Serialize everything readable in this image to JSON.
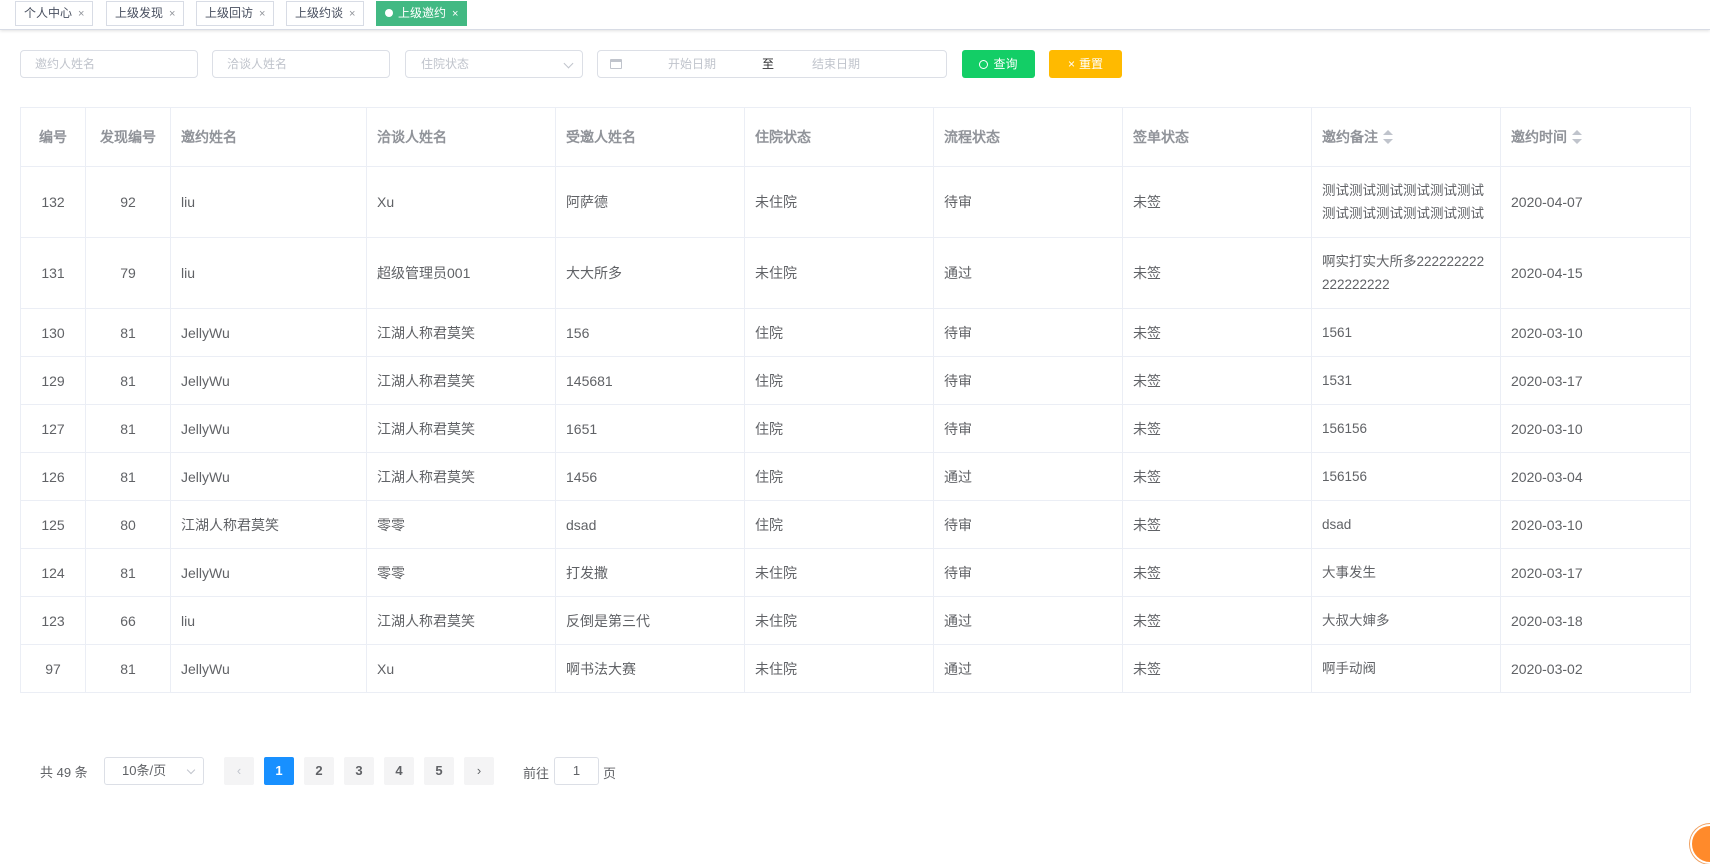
{
  "tabs": [
    {
      "label": "个人中心",
      "active": false
    },
    {
      "label": "上级发现",
      "active": false
    },
    {
      "label": "上级回访",
      "active": false
    },
    {
      "label": "上级约谈",
      "active": false
    },
    {
      "label": "上级邀约",
      "active": true
    }
  ],
  "tab_close_glyph": "×",
  "filters": {
    "inviter_placeholder": "邀约人姓名",
    "negotiator_placeholder": "洽谈人姓名",
    "status_placeholder": "住院状态",
    "date_start_placeholder": "开始日期",
    "date_separator": "至",
    "date_end_placeholder": "结束日期",
    "search_label": "查询",
    "reset_label": "重置"
  },
  "table": {
    "headers": [
      "编号",
      "发现编号",
      "邀约姓名",
      "洽谈人姓名",
      "受邀人姓名",
      "住院状态",
      "流程状态",
      "签单状态",
      "邀约备注",
      "邀约时间"
    ],
    "rows": [
      [
        "132",
        "92",
        "liu",
        "Xu",
        "阿萨德",
        "未住院",
        "待审",
        "未签",
        "测试测试测试测试测试测试测试测试测试测试测试测试",
        "2020-04-07"
      ],
      [
        "131",
        "79",
        "liu",
        "超级管理员001",
        "大大所多",
        "未住院",
        "通过",
        "未签",
        "啊实打实大所多222222222222222222",
        "2020-04-15"
      ],
      [
        "130",
        "81",
        "JellyWu",
        "江湖人称君莫笑",
        "156",
        "住院",
        "待审",
        "未签",
        "1561",
        "2020-03-10"
      ],
      [
        "129",
        "81",
        "JellyWu",
        "江湖人称君莫笑",
        "145681",
        "住院",
        "待审",
        "未签",
        "1531",
        "2020-03-17"
      ],
      [
        "127",
        "81",
        "JellyWu",
        "江湖人称君莫笑",
        "1651",
        "住院",
        "待审",
        "未签",
        "156156",
        "2020-03-10"
      ],
      [
        "126",
        "81",
        "JellyWu",
        "江湖人称君莫笑",
        "1456",
        "住院",
        "通过",
        "未签",
        "156156",
        "2020-03-04"
      ],
      [
        "125",
        "80",
        "江湖人称君莫笑",
        "零零",
        "dsad",
        "住院",
        "待审",
        "未签",
        "dsad",
        "2020-03-10"
      ],
      [
        "124",
        "81",
        "JellyWu",
        "零零",
        "打发撒",
        "未住院",
        "待审",
        "未签",
        "大事发生",
        "2020-03-17"
      ],
      [
        "123",
        "66",
        "liu",
        "江湖人称君莫笑",
        "反倒是第三代",
        "未住院",
        "通过",
        "未签",
        "大叔大婶多",
        "2020-03-18"
      ],
      [
        "97",
        "81",
        "JellyWu",
        "Xu",
        "啊书法大赛",
        "未住院",
        "通过",
        "未签",
        "啊手动阀",
        "2020-03-02"
      ]
    ]
  },
  "pagination": {
    "total_text": "共 49 条",
    "page_size": "10条/页",
    "pages": [
      "1",
      "2",
      "3",
      "4",
      "5"
    ],
    "current_page": "1",
    "goto_prefix": "前往",
    "goto_value": "1",
    "goto_suffix": "页"
  },
  "colors": {
    "active_tab": "#42b983",
    "search_button": "#13ce66",
    "reset_button": "#ffba00",
    "active_page": "#1890ff"
  }
}
